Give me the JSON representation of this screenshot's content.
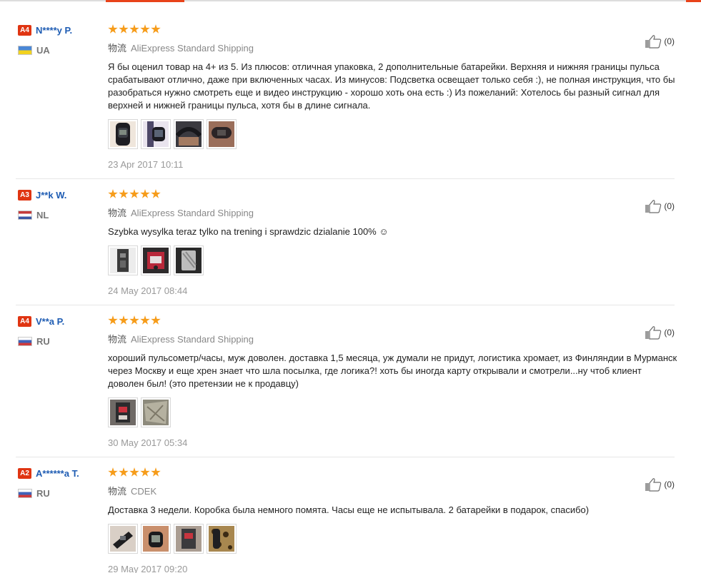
{
  "reviews": [
    {
      "level": "A4",
      "user": "N****y P.",
      "country": "UA",
      "stars": 5,
      "shipping_label": "物流",
      "shipping": "AliExpress Standard Shipping",
      "text": "Я бы оценил товар на 4+ из 5. Из плюсов: отличная упаковка, 2 дополнительные батарейки. Верхняя и нижняя границы пульса срабатывают отлично, даже при включенных часах. Из минусов: Подсветка освещает только себя :), не полная инструкция, что бы разобраться нужно смотреть еще и видео инструкцию - хорошо хоть она есть :) Из пожеланий: Хотелось бы разный сигнал для верхней и нижней границы пульса, хотя бы в длине сигнала.",
      "photos": 4,
      "date": "23 Apr 2017 10:11",
      "likes": "(0)"
    },
    {
      "level": "A3",
      "user": "J**k W.",
      "country": "NL",
      "stars": 5,
      "shipping_label": "物流",
      "shipping": "AliExpress Standard Shipping",
      "text": "Szybka wysylka teraz tylko na trening i sprawdzic dzialanie 100% ☺",
      "photos": 3,
      "date": "24 May 2017 08:44",
      "likes": "(0)"
    },
    {
      "level": "A4",
      "user": "V**a P.",
      "country": "RU",
      "stars": 5,
      "shipping_label": "物流",
      "shipping": "AliExpress Standard Shipping",
      "text": "хороший пульсометр/часы, муж доволен. доставка 1,5 месяца, уж думали не придут, логистика хромает, из Финляндии в Мурманск через Москву и еще хрен знает что шла посылка, где логика?! хоть бы иногда карту открывали и смотрели...ну чтоб клиент доволен был! (это претензии не к продавцу)",
      "photos": 2,
      "date": "30 May 2017 05:34",
      "likes": "(0)"
    },
    {
      "level": "A2",
      "user": "A******a T.",
      "country": "RU",
      "stars": 5,
      "shipping_label": "物流",
      "shipping": "CDEK",
      "text": "Доставка 3 недели. Коробка была немного помята. Часы еще не испытывала. 2 батарейки в подарок, спасибо)",
      "photos": 4,
      "date": "29 May 2017 09:20",
      "likes": "(0)"
    }
  ],
  "colors": {
    "accent": "#e8431a",
    "star": "#f69c1a",
    "username": "#1e5cb3",
    "level_badge": "#e03512"
  },
  "icons": {
    "like": "thumbs-up-icon",
    "rating": "star-icon"
  }
}
